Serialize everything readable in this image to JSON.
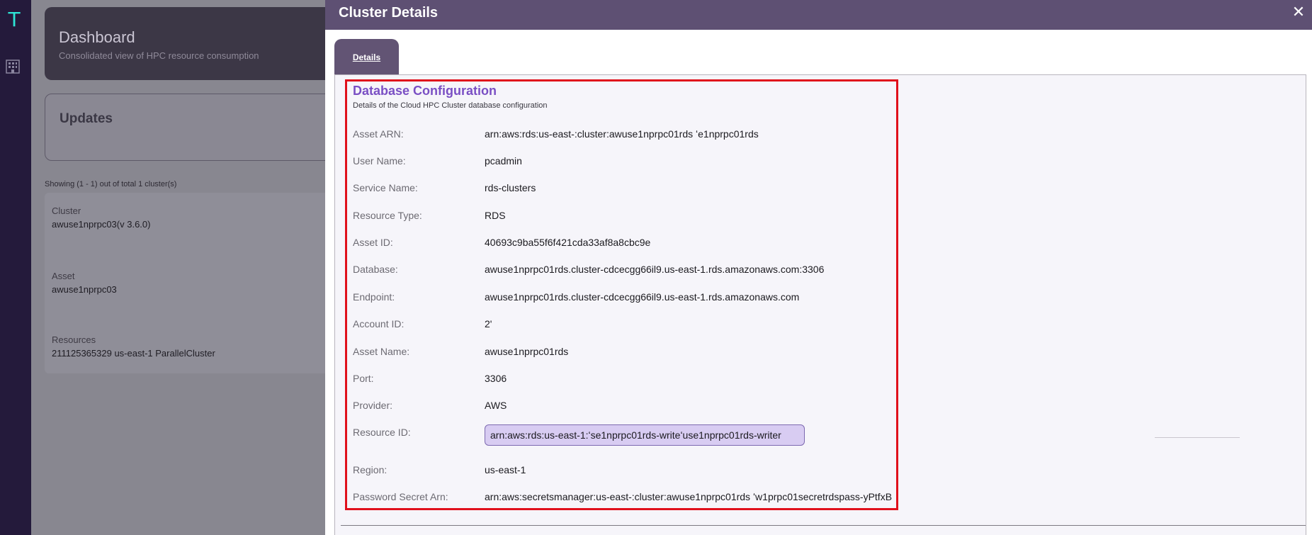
{
  "rail": {
    "logo": "T",
    "icons": [
      "building-icon"
    ]
  },
  "dashboard": {
    "title": "Dashboard",
    "subtitle": "Consolidated view of HPC resource consumption",
    "updates_title": "Updates",
    "showing": "Showing (1 - 1) out of total 1 cluster(s)",
    "cluster": {
      "cluster_label": "Cluster",
      "cluster_value": "awuse1nprpc03(v 3.6.0)",
      "asset_label": "Asset",
      "asset_value": "awuse1nprpc03",
      "resources_label": "Resources",
      "resources_value": "211125365329 us-east-1 ParallelCluster"
    }
  },
  "modal": {
    "title": "Cluster Details",
    "close_icon": "close-icon",
    "tabs": [
      {
        "label": "Details",
        "active": true
      }
    ],
    "section": {
      "title": "Database Configuration",
      "subtitle": "Details of the Cloud HPC Cluster database configuration"
    },
    "rows": [
      {
        "label": "Asset ARN:",
        "value": "arn:aws:rds:us-east-:cluster:awuse1nprpc01rds   ʻe1nprpc01rds"
      },
      {
        "label": "User Name:",
        "value": "pcadmin"
      },
      {
        "label": "Service Name:",
        "value": "rds-clusters"
      },
      {
        "label": "Resource Type:",
        "value": "RDS"
      },
      {
        "label": "Asset ID:",
        "value": "40693c9ba55f6f421cda33af8a8cbc9e"
      },
      {
        "label": "Database:",
        "value": "awuse1nprpc01rds.cluster-cdcecgg66il9.us-east-1.rds.amazonaws.com:3306"
      },
      {
        "label": "Endpoint:",
        "value": "awuse1nprpc01rds.cluster-cdcecgg66il9.us-east-1.rds.amazonaws.com"
      },
      {
        "label": "Account ID:",
        "value": "2'"
      },
      {
        "label": "Asset Name:",
        "value": "awuse1nprpc01rds"
      },
      {
        "label": "Port:",
        "value": "3306"
      },
      {
        "label": "Provider:",
        "value": "AWS"
      },
      {
        "label": "Resource ID:",
        "value": "arn:aws:rds:us-east-1:ʻse1nprpc01rds-writeʻuse1nprpc01rds-writer"
      },
      {
        "label": "Region:",
        "value": "us-east-1"
      },
      {
        "label": "Password Secret Arn:",
        "value": "arn:aws:secretsmanager:us-east-:cluster:awuse1nprpc01rds   ʻw1prpc01secretrdspass-yPtfxB"
      }
    ]
  },
  "colors": {
    "rail": "#241a3b",
    "header": "#5e5073",
    "accent": "#7a4fc4",
    "highlight": "#e0101c",
    "chip": "#d8ccf2"
  }
}
